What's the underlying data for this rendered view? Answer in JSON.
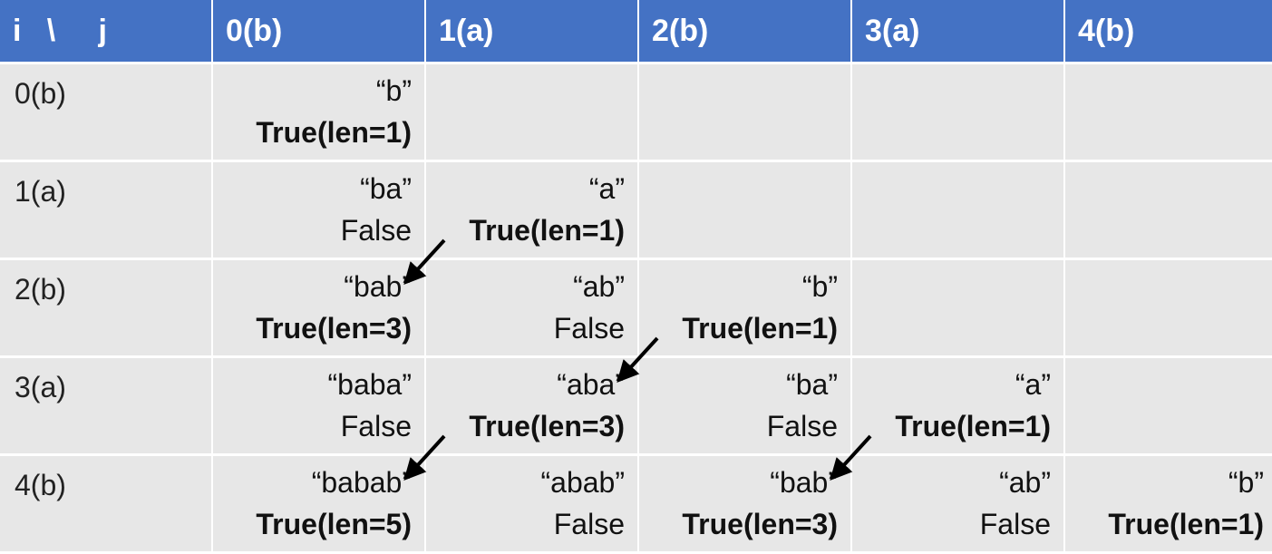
{
  "header": {
    "corner": "i   \\     j",
    "columns": [
      "0(b)",
      "1(a)",
      "2(b)",
      "3(a)",
      "4(b)"
    ]
  },
  "rows": [
    {
      "label": "0(b)",
      "cells": [
        {
          "s": "“b”",
          "v": "True(len=1)"
        },
        null,
        null,
        null,
        null
      ]
    },
    {
      "label": "1(a)",
      "cells": [
        {
          "s": "“ba”",
          "v": "False"
        },
        {
          "s": "“a”",
          "v": "True(len=1)"
        },
        null,
        null,
        null
      ]
    },
    {
      "label": "2(b)",
      "cells": [
        {
          "s": "“bab”",
          "v": "True(len=3)"
        },
        {
          "s": "“ab”",
          "v": "False"
        },
        {
          "s": "“b”",
          "v": "True(len=1)"
        },
        null,
        null
      ]
    },
    {
      "label": "3(a)",
      "cells": [
        {
          "s": "“baba”",
          "v": "False"
        },
        {
          "s": "“aba”",
          "v": "True(len=3)"
        },
        {
          "s": "“ba”",
          "v": "False"
        },
        {
          "s": "“a”",
          "v": "True(len=1)"
        },
        null
      ]
    },
    {
      "label": "4(b)",
      "cells": [
        {
          "s": "“babab”",
          "v": "True(len=5)"
        },
        {
          "s": "“abab”",
          "v": "False"
        },
        {
          "s": "“bab”",
          "v": "True(len=3)"
        },
        {
          "s": "“ab”",
          "v": "False"
        },
        {
          "s": "“b”",
          "v": "True(len=1)"
        }
      ]
    }
  ],
  "arrows": [
    {
      "from": [
        1,
        1
      ],
      "to": [
        2,
        0
      ]
    },
    {
      "from": [
        2,
        2
      ],
      "to": [
        3,
        1
      ]
    },
    {
      "from": [
        3,
        1
      ],
      "to": [
        4,
        0
      ]
    },
    {
      "from": [
        3,
        3
      ],
      "to": [
        4,
        2
      ]
    }
  ],
  "colors": {
    "header": "#4472c4",
    "cell": "#e7e7e7",
    "arrow": "#000000"
  }
}
